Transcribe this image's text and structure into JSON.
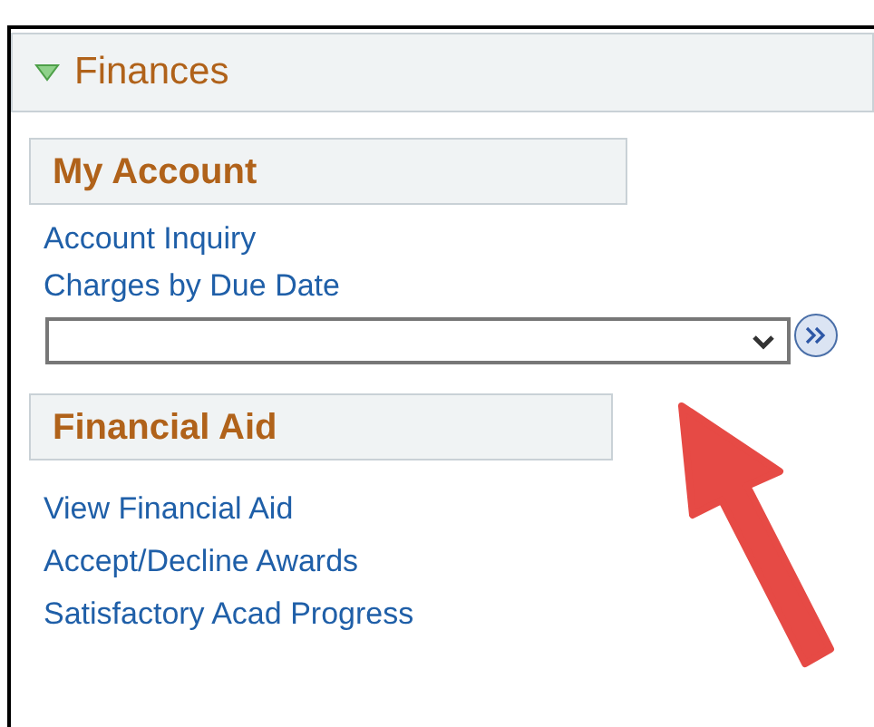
{
  "panel": {
    "title": "Finances",
    "expanded": true
  },
  "sections": [
    {
      "title": "My Account",
      "links": [
        "Account Inquiry",
        "Charges by Due Date"
      ],
      "has_select": true
    },
    {
      "title": "Financial Aid",
      "links": [
        "View Financial Aid",
        "Accept/Decline Awards",
        "Satisfactory Acad Progress"
      ],
      "has_select": false
    }
  ]
}
